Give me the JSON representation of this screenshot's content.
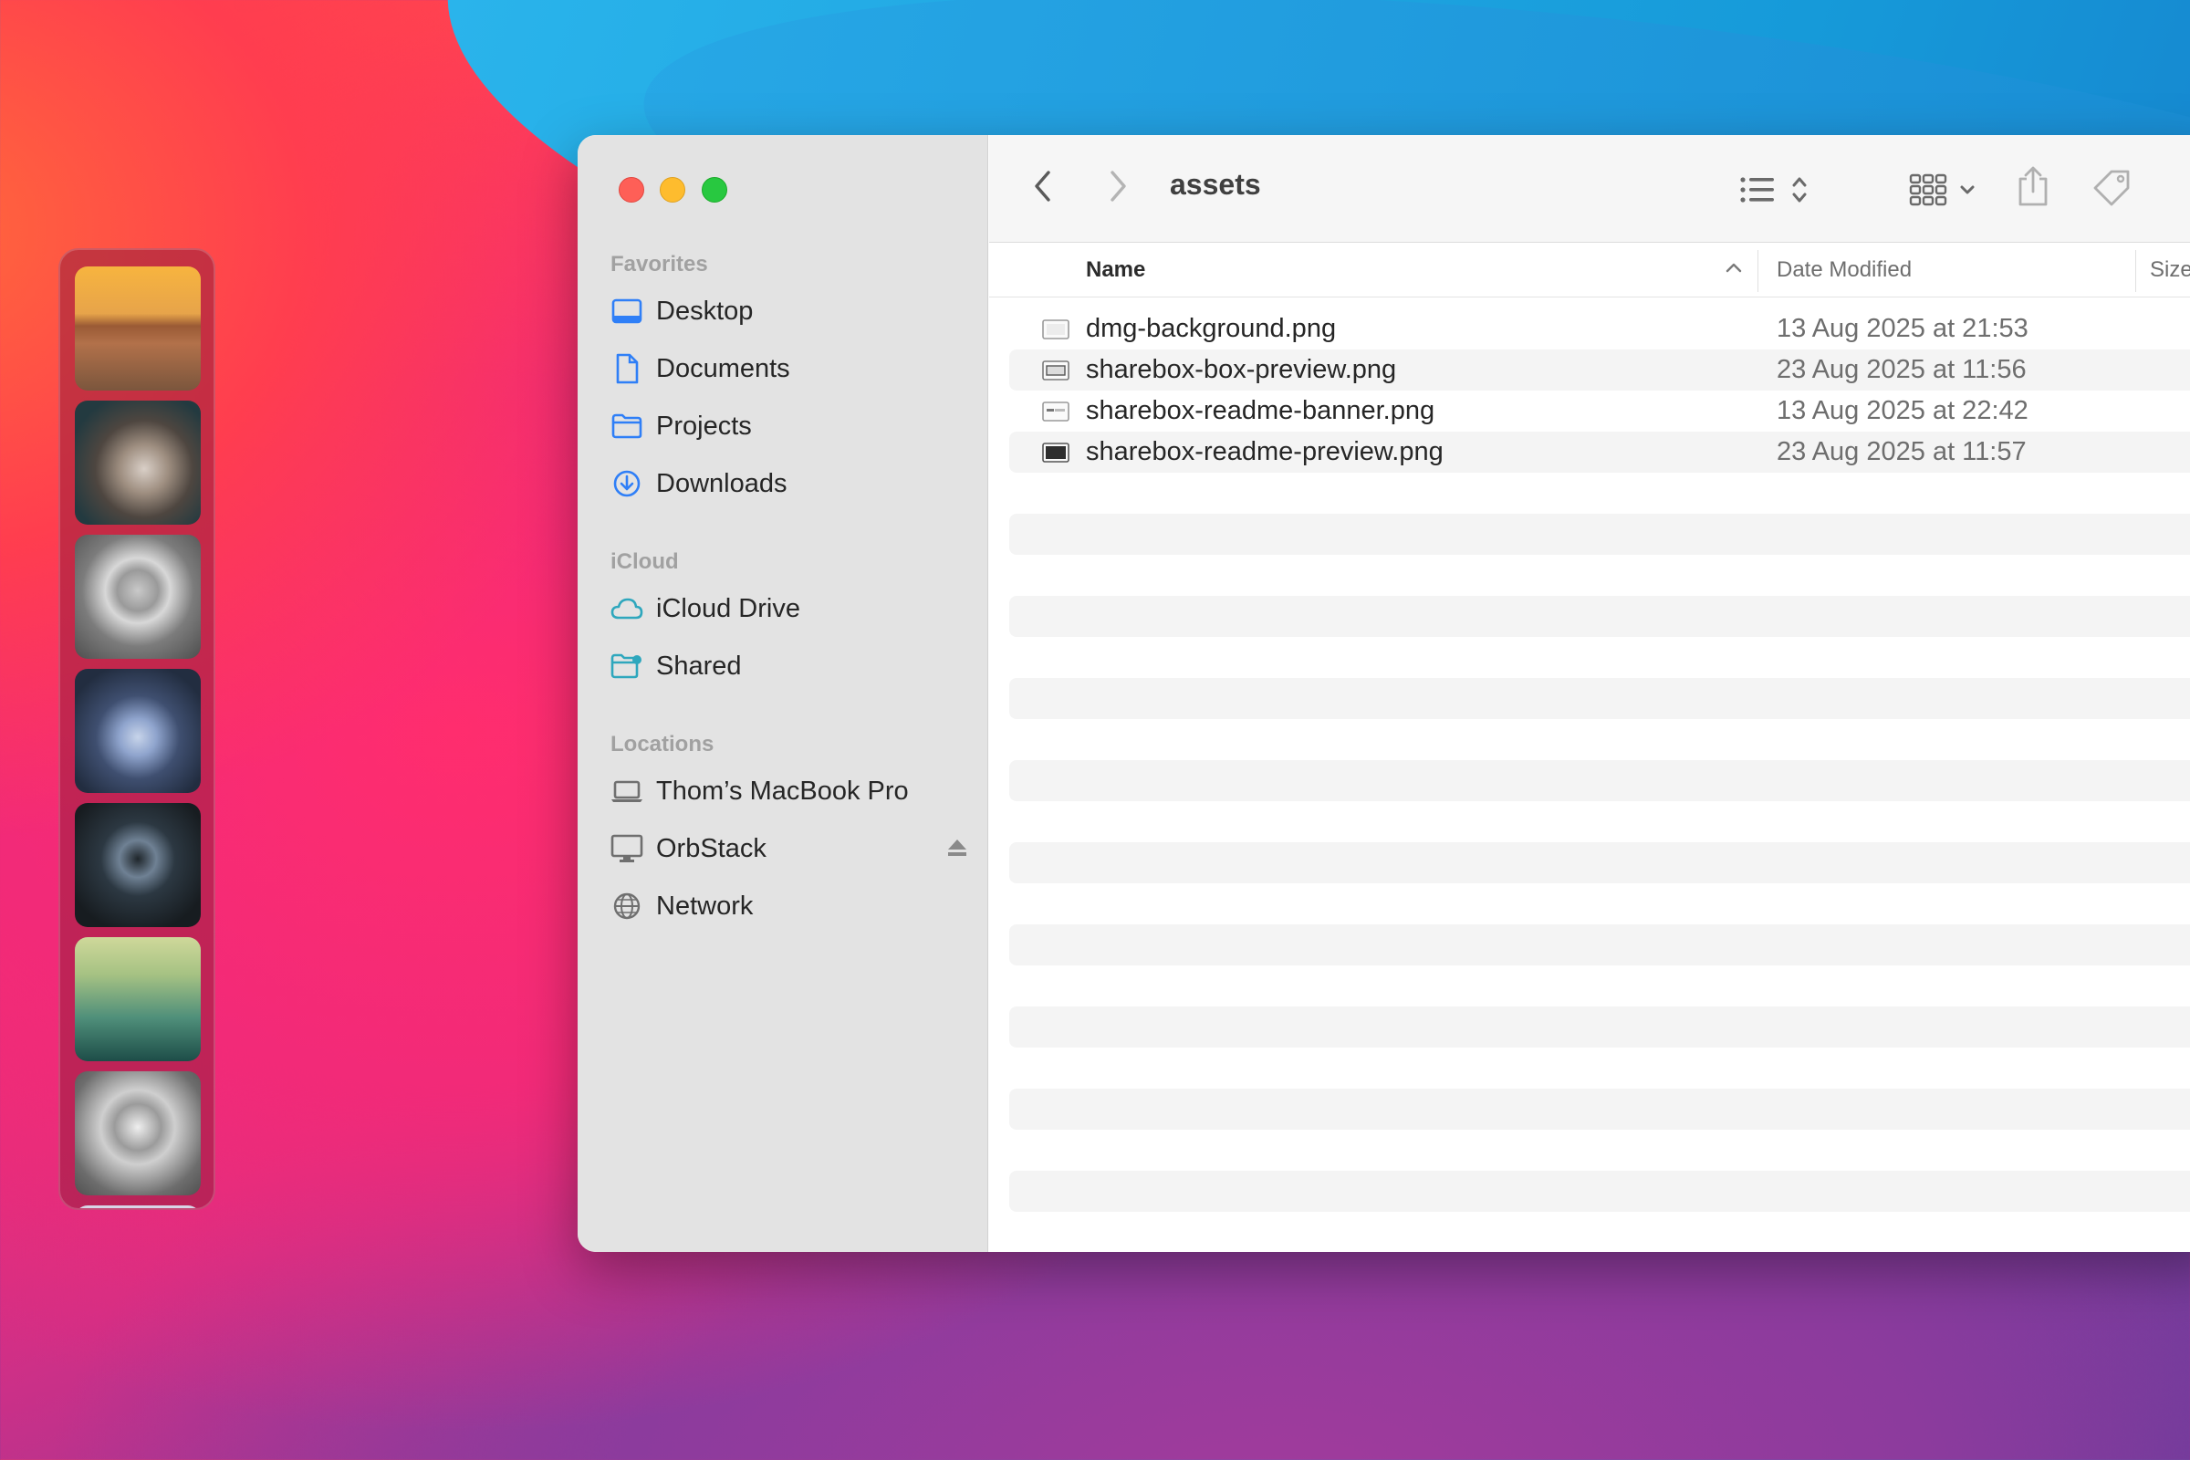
{
  "window": {
    "title": "assets"
  },
  "sidebar": {
    "sections": [
      {
        "title": "Favorites",
        "items": [
          {
            "label": "Desktop",
            "icon": "desktop-icon"
          },
          {
            "label": "Documents",
            "icon": "document-icon"
          },
          {
            "label": "Projects",
            "icon": "folder-icon"
          },
          {
            "label": "Downloads",
            "icon": "download-icon"
          }
        ]
      },
      {
        "title": "iCloud",
        "items": [
          {
            "label": "iCloud Drive",
            "icon": "cloud-icon"
          },
          {
            "label": "Shared",
            "icon": "shared-folder-icon"
          }
        ]
      },
      {
        "title": "Locations",
        "items": [
          {
            "label": "Thom’s MacBook Pro",
            "icon": "laptop-icon"
          },
          {
            "label": "OrbStack",
            "icon": "display-icon",
            "eject": "eject-icon"
          },
          {
            "label": "Network",
            "icon": "globe-icon"
          }
        ]
      }
    ]
  },
  "table": {
    "columns": [
      "Name",
      "Date Modified",
      "Size"
    ],
    "sort_column": "Name",
    "rows": [
      {
        "name": "dmg-background.png",
        "date": "13 Aug 2025 at 21:53"
      },
      {
        "name": "sharebox-box-preview.png",
        "date": "23 Aug 2025 at 11:56"
      },
      {
        "name": "sharebox-readme-banner.png",
        "date": "13 Aug 2025 at 22:42"
      },
      {
        "name": "sharebox-readme-preview.png",
        "date": "23 Aug 2025 at 11:57"
      }
    ]
  },
  "colors": {
    "accent": "#2f7ff7",
    "close": "#fe5f57",
    "minimize": "#febc2e",
    "maximize": "#28c840"
  }
}
